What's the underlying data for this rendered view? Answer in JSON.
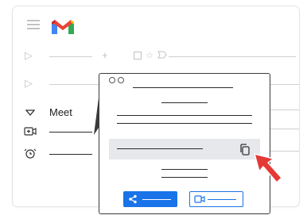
{
  "sidebar": {
    "meet_label": "Meet"
  },
  "colors": {
    "gmail_red": "#EA4335",
    "gmail_blue": "#4285F4",
    "gmail_green": "#34A853",
    "gmail_yellow": "#FBBC04",
    "button_blue": "#1A73E8",
    "cursor_red": "#E53935",
    "link_row_bg": "#E6E8EC"
  },
  "icons": {
    "menu": "hamburger-icon",
    "logo": "gmail-logo",
    "expand": "triangle-right-icon",
    "add": "plus-icon",
    "meet_toggle": "triangle-down-icon",
    "new_meeting": "video-camera-plus-icon",
    "schedule": "alarm-clock-icon",
    "copy": "copy-icon",
    "share": "share-icon",
    "join": "video-camera-icon",
    "pointer": "arrow-cursor-icon"
  }
}
